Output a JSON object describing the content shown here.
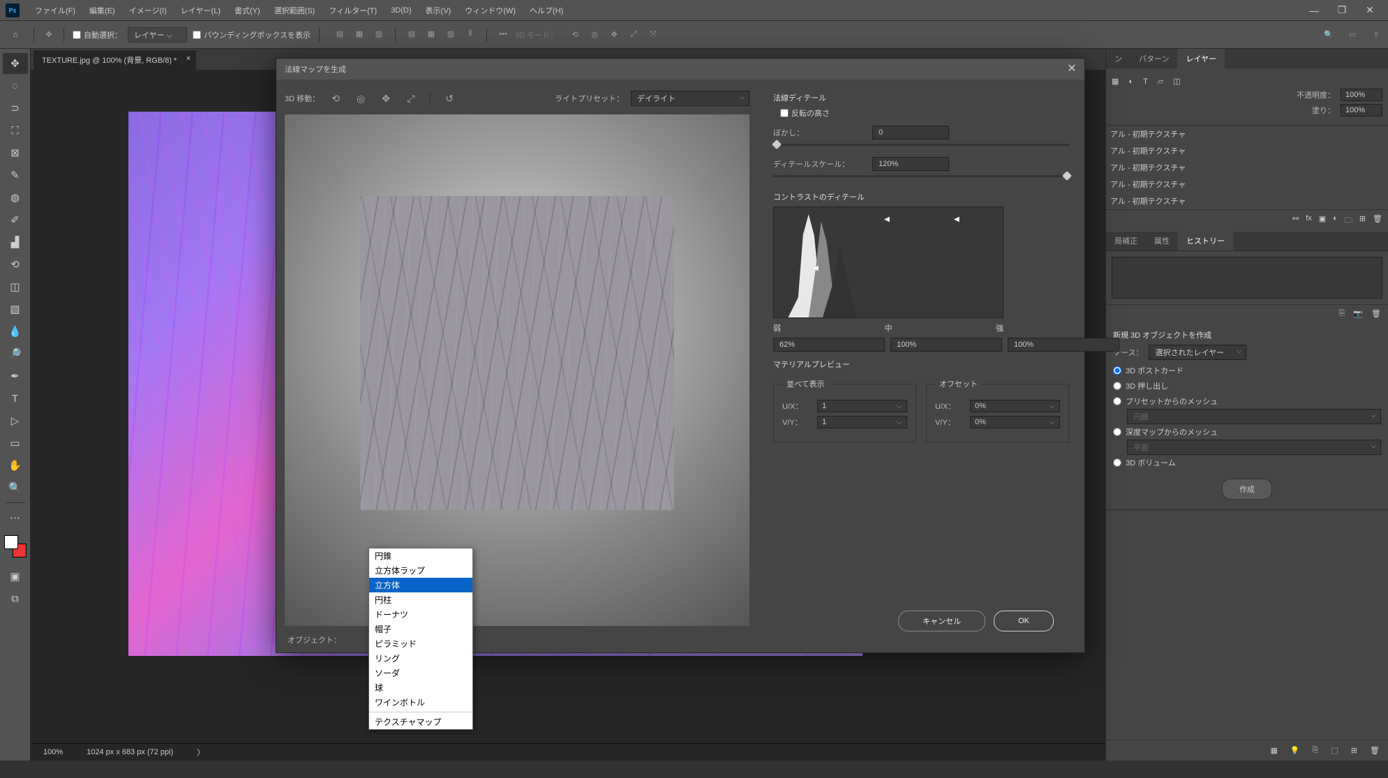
{
  "menubar": {
    "items": [
      "ファイル(F)",
      "編集(E)",
      "イメージ(I)",
      "レイヤー(L)",
      "書式(Y)",
      "選択範囲(S)",
      "フィルター(T)",
      "3D(D)",
      "表示(V)",
      "ウィンドウ(W)",
      "ヘルプ(H)"
    ]
  },
  "options": {
    "auto_select": "自動選択：",
    "layer_type": "レイヤー",
    "bounding": "バウンディングボックスを表示",
    "mode_3d": "3D モード："
  },
  "doc_tab": "TEXTURE.jpg @ 100% (背景, RGB/8) *",
  "status": {
    "zoom": "100%",
    "dims": "1024 px x 683 px (72 ppi)"
  },
  "panels": {
    "tabs_top": [
      "ン",
      "パターン",
      "レイヤー"
    ],
    "opacity_label": "不透明度：",
    "opacity": "100%",
    "fill_label": "塗り：",
    "fill": "100%",
    "layers": [
      "アル - 初期テクスチャ",
      "アル - 初期テクスチャ",
      "アル - 初期テクスチャ",
      "アル - 初期テクスチャ",
      "アル - 初期テクスチャ"
    ],
    "tabs_mid": [
      "局補正",
      "属性",
      "ヒストリー"
    ],
    "new3d": "新規 3D オブジェクトを作成",
    "source_label": "ソース：",
    "source": "選択されたレイヤー",
    "radios": [
      "3D ポストカード",
      "3D 押し出し",
      "プリセットからのメッシュ",
      "深度マップからのメッシュ",
      "3D ボリューム"
    ],
    "preset_disabled": "円錐",
    "depth_disabled": "平面",
    "create": "作成"
  },
  "dialog": {
    "title": "法線マップを生成",
    "move_3d": "3D 移動：",
    "light_label": "ライトプリセット：",
    "light": "デイライト",
    "object_label": "オブジェクト：",
    "normal_detail": "法線ディテール",
    "invert": "反転の高さ",
    "blur_label": "ぼかし：",
    "blur": "0",
    "scale_label": "ディテールスケール：",
    "scale": "120%",
    "contrast_detail": "コントラストのディテール",
    "hist_labels": [
      "弱",
      "中",
      "強"
    ],
    "hist_vals": [
      "62%",
      "100%",
      "100%"
    ],
    "mat_preview": "マテリアルプレビュー",
    "tiling": "並べて表示",
    "offset": "オフセット",
    "ux": "U/X：",
    "vy": "V/Y：",
    "t1": "1",
    "t2": "1",
    "o1": "0%",
    "o2": "0%",
    "cancel": "キャンセル",
    "ok": "OK"
  },
  "dropdown": {
    "items": [
      "円錐",
      "立方体ラップ",
      "立方体",
      "円柱",
      "ドーナツ",
      "帽子",
      "ピラミッド",
      "リング",
      "ソーダ",
      "球",
      "ワインボトル"
    ],
    "last": "テクスチャマップ",
    "selected": 2
  }
}
